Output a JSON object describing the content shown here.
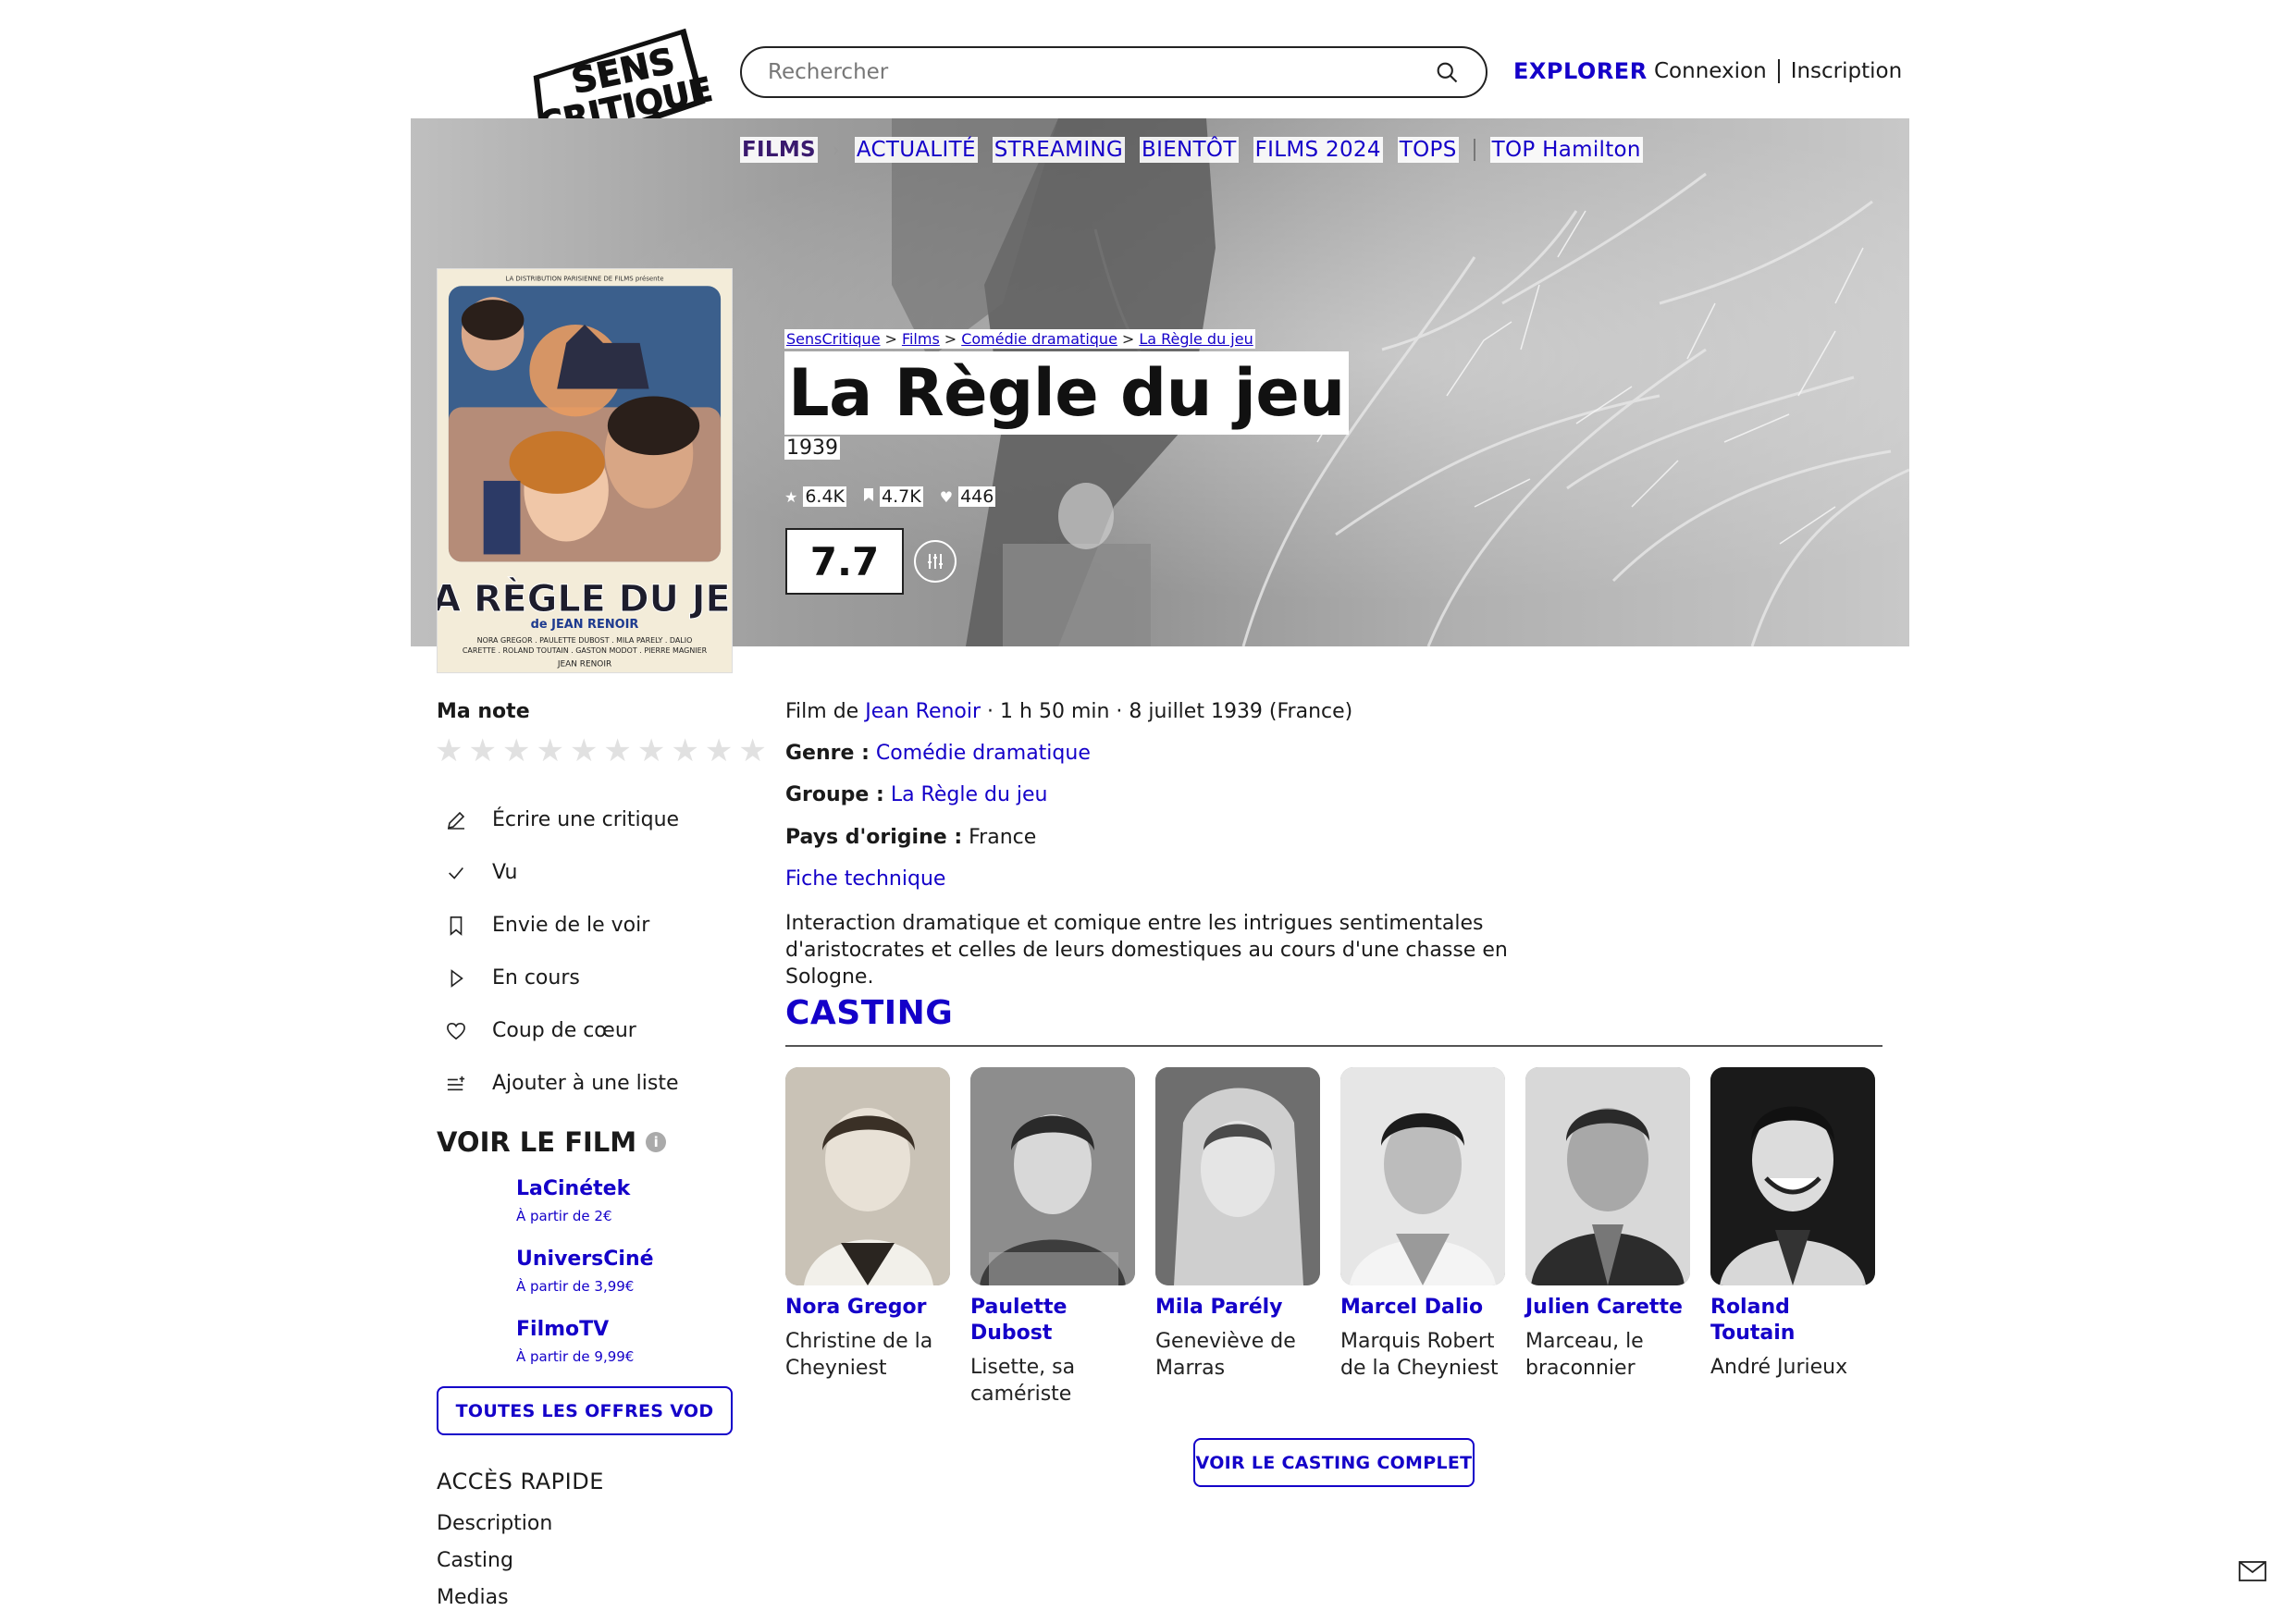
{
  "colors": {
    "accent": "#1400c9",
    "nav_first": "#3a1a6e",
    "star_empty": "#e1e1e1"
  },
  "logo": {
    "line1": "SENS",
    "line2": "CRITIQUE"
  },
  "header": {
    "search_placeholder": "Rechercher",
    "explorer": "EXPLORER",
    "login": "Connexion",
    "signup": "Inscription"
  },
  "nav": {
    "first": "FILMS",
    "items": [
      "ACTUALITÉ",
      "STREAMING",
      "BIENTÔT",
      "FILMS 2024",
      "TOPS"
    ],
    "last": "TOP Hamilton"
  },
  "breadcrumb": [
    "SensCritique",
    "Films",
    "Comédie dramatique",
    "La Règle du jeu"
  ],
  "movie": {
    "title": "La Règle du jeu",
    "year": "1939",
    "stats": {
      "ratings": "6.4K",
      "wishes": "4.7K",
      "hearts": "446"
    },
    "score": "7.7",
    "poster": {
      "top": "LA DISTRIBUTION PARISIENNE DE FILMS présente",
      "title": "LA RÈGLE DU JEU",
      "by": "de JEAN RENOIR",
      "cast1": "NORA GREGOR . PAULETTE DUBOST . MILA PARELY . DALIO",
      "cast2": "CARETTE . ROLAND TOUTAIN . GASTON MODOT . PIERRE MAGNIER",
      "bottom": "JEAN RENOIR"
    }
  },
  "my_rating": {
    "label": "Ma note"
  },
  "actions": [
    "Écrire une critique",
    "Vu",
    "Envie de le voir",
    "En cours",
    "Coup de cœur",
    "Ajouter à une liste"
  ],
  "watch": {
    "title": "VOIR LE FILM",
    "providers": [
      {
        "name": "LaCinétek",
        "price": "À partir de 2€"
      },
      {
        "name": "UniversCiné",
        "price": "À partir de 3,99€"
      },
      {
        "name": "FilmoTV",
        "price": "À partir de 9,99€"
      }
    ],
    "all_offers": "TOUTES LES OFFRES VOD"
  },
  "quick_access": {
    "title": "ACCÈS RAPIDE",
    "items": [
      "Description",
      "Casting",
      "Medias"
    ]
  },
  "details": {
    "film_by_prefix": "Film de ",
    "director": "Jean Renoir",
    "meta": " · 1 h 50 min · 8 juillet 1939 (France)",
    "genre_label": "Genre :",
    "genre": "Comédie dramatique",
    "group_label": "Groupe :",
    "group": "La Règle du jeu",
    "country_label": "Pays d'origine :",
    "country": "France",
    "tech_sheet": "Fiche technique",
    "synopsis": "Interaction dramatique et comique entre les intrigues sentimentales d'aristocrates et celles de leurs domestiques au cours d'une chasse en Sologne."
  },
  "casting": {
    "title": "CASTING",
    "members": [
      {
        "name": "Nora Gregor",
        "role": "Christine de la Cheyniest"
      },
      {
        "name": "Paulette Dubost",
        "role": "Lisette, sa camériste"
      },
      {
        "name": "Mila Parély",
        "role": "Geneviève de Marras"
      },
      {
        "name": "Marcel Dalio",
        "role": "Marquis Robert de la Cheyniest"
      },
      {
        "name": "Julien Carette",
        "role": "Marceau, le braconnier"
      },
      {
        "name": "Roland Toutain",
        "role": "André Jurieux"
      }
    ],
    "full_button": "VOIR LE CASTING COMPLET"
  }
}
